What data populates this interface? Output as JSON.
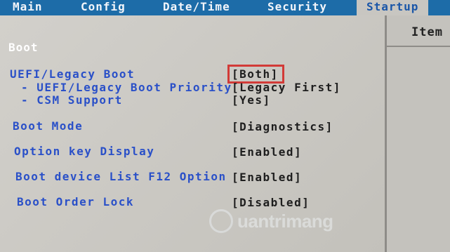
{
  "tabs": [
    {
      "label": "Main"
    },
    {
      "label": "Config"
    },
    {
      "label": "Date/Time"
    },
    {
      "label": "Security"
    },
    {
      "label": "Startup",
      "active": true
    }
  ],
  "help_panel": {
    "title": "Item"
  },
  "section": {
    "title": "Boot"
  },
  "settings": [
    {
      "label": "UEFI/Legacy Boot",
      "value": "[Both]",
      "selected": true
    },
    {
      "label": "- UEFI/Legacy Boot Priority",
      "value": "[Legacy First]"
    },
    {
      "label": "- CSM Support",
      "value": "[Yes]"
    },
    {
      "label": "Boot Mode",
      "value": "[Diagnostics]"
    },
    {
      "label": "Option key Display",
      "value": "[Enabled]"
    },
    {
      "label": "Boot device List F12 Option",
      "value": "[Enabled]"
    },
    {
      "label": "Boot Order Lock",
      "value": "[Disabled]"
    }
  ],
  "watermark": {
    "text": "uantrimang"
  },
  "colors": {
    "tabbar_bg": "#1d6ca8",
    "label": "#2a50c8",
    "value": "#1e1e1e",
    "selection_box": "#d23a37",
    "panel_bg": "#c8c6c1"
  }
}
